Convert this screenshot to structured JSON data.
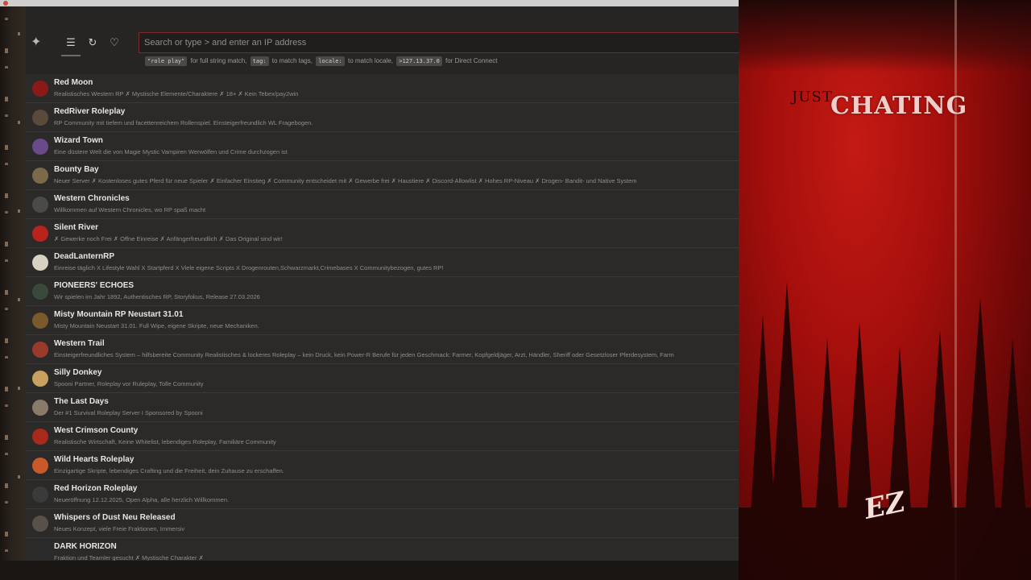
{
  "header": {
    "search_placeholder": "Search or type > and enter an IP address",
    "hints": {
      "code1": "\"role play\"",
      "text1": "for full string match,",
      "code2": "tag:",
      "text2": "to match tags,",
      "code3": "locale:",
      "text3": "to match locale,",
      "code4": ">127.13.37.0",
      "text4": "for Direct Connect"
    }
  },
  "servers": [
    {
      "name": "Red Moon",
      "desc": "Realistisches Western RP ✗ Mystische Elemente/Charaktere ✗ 18+ ✗ Kein Tebex/pay2win",
      "color": "#8a1a17"
    },
    {
      "name": "RedRiver Roleplay",
      "desc": "RP Community mit tiefem und facettenreichem Rollenspiel. Einsteigerfreundlich WL Fragebogen.",
      "color": "#5a4a3a"
    },
    {
      "name": "Wizard Town",
      "desc": "Eine düstere Welt die von Magie Mystic Vampiren Werwölfen und Crime durchzogen ist",
      "color": "#6b4a8a"
    },
    {
      "name": "Bounty Bay",
      "desc": "Neuer Server ✗ Kostenloses gutes Pferd für neue Spieler ✗ Einfacher Einstieg ✗ Community entscheidet mit ✗ Gewerbe frei ✗ Haustiere ✗ Discord-Allowlist ✗ Hohes RP-Niveau ✗ Drogen- Bandit- und Native System",
      "color": "#7a6a4a"
    },
    {
      "name": "Western Chronicles",
      "desc": "Willkommen auf Western Chronicles, wo RP spaß macht",
      "color": "#4a4a48"
    },
    {
      "name": "Silent River",
      "desc": "✗ Gewerke noch Frei ✗ Offne Einreise ✗ Anfängerfreundlich ✗ Das Original sind wir!",
      "color": "#b8241c"
    },
    {
      "name": "DeadLanternRP",
      "desc": "Einreise täglich X Lifestyle Wahl X Startpferd X Viele eigene Scripts X Drogenrouten,Schwarzmarkt,Crimebases X Communitybezogen, gutes RP!",
      "color": "#d8d0c0"
    },
    {
      "name": "PIONEERS' ECHOES",
      "desc": "Wir spielen im Jahr 1892, Authentisches RP, Storyfokus, Release 27.03.2026",
      "color": "#3a4a3a"
    },
    {
      "name": "Misty Mountain RP Neustart 31.01",
      "desc": "Misty Mountain Neustart 31.01. Full Wipe, eigene Skripte, neue Mechaniken.",
      "color": "#7a5a2a"
    },
    {
      "name": "Western Trail",
      "desc": "Einsteigerfreundliches System – hilfsbereite Community Realistisches & lockeres Roleplay – kein Druck, kein Power-R Berufe für jeden Geschmack: Farmer, Kopfgeldjäger, Arzt, Händler, Sheriff oder Gesetzloser Pferdesystem, Farm",
      "color": "#9a3a2a"
    },
    {
      "name": "Silly Donkey",
      "desc": "Spooni Partner, Roleplay vor Ruleplay, Tolle Community",
      "color": "#c8a060"
    },
    {
      "name": "The Last Days",
      "desc": "Der #1 Survival Roleplay Server I Sponsored by Spooni",
      "color": "#8a7a6a"
    },
    {
      "name": "West Crimson County",
      "desc": "Realistische Wirtschaft, Keine Whitelist, lebendiges Roleplay, Familiäre Community",
      "color": "#a82a1a"
    },
    {
      "name": "Wild Hearts Roleplay",
      "desc": "Einzigartige Skripte, lebendiges Crafting und die Freiheit, dein Zuhause zu erschaffen.",
      "color": "#c85a2a"
    },
    {
      "name": "Red Horizon Roleplay",
      "desc": "Neueröffnung 12.12.2025, Open Alpha, alle herzlich Willkommen.",
      "color": "#3a3a3a"
    },
    {
      "name": "Whispers of Dust Neu Released",
      "desc": "Neues Konzept, viele Freie Fraktionen, Immersiv",
      "color": "#5a5048"
    },
    {
      "name": "DARK HORIZON",
      "desc": "Fraktion und Teamler gesucht ✗ Mystische Charakter ✗",
      "color": "#2a2a2a"
    }
  ],
  "stream": {
    "title_small": "JUST",
    "title_big": "CHATING",
    "logo_text": "EZ"
  }
}
